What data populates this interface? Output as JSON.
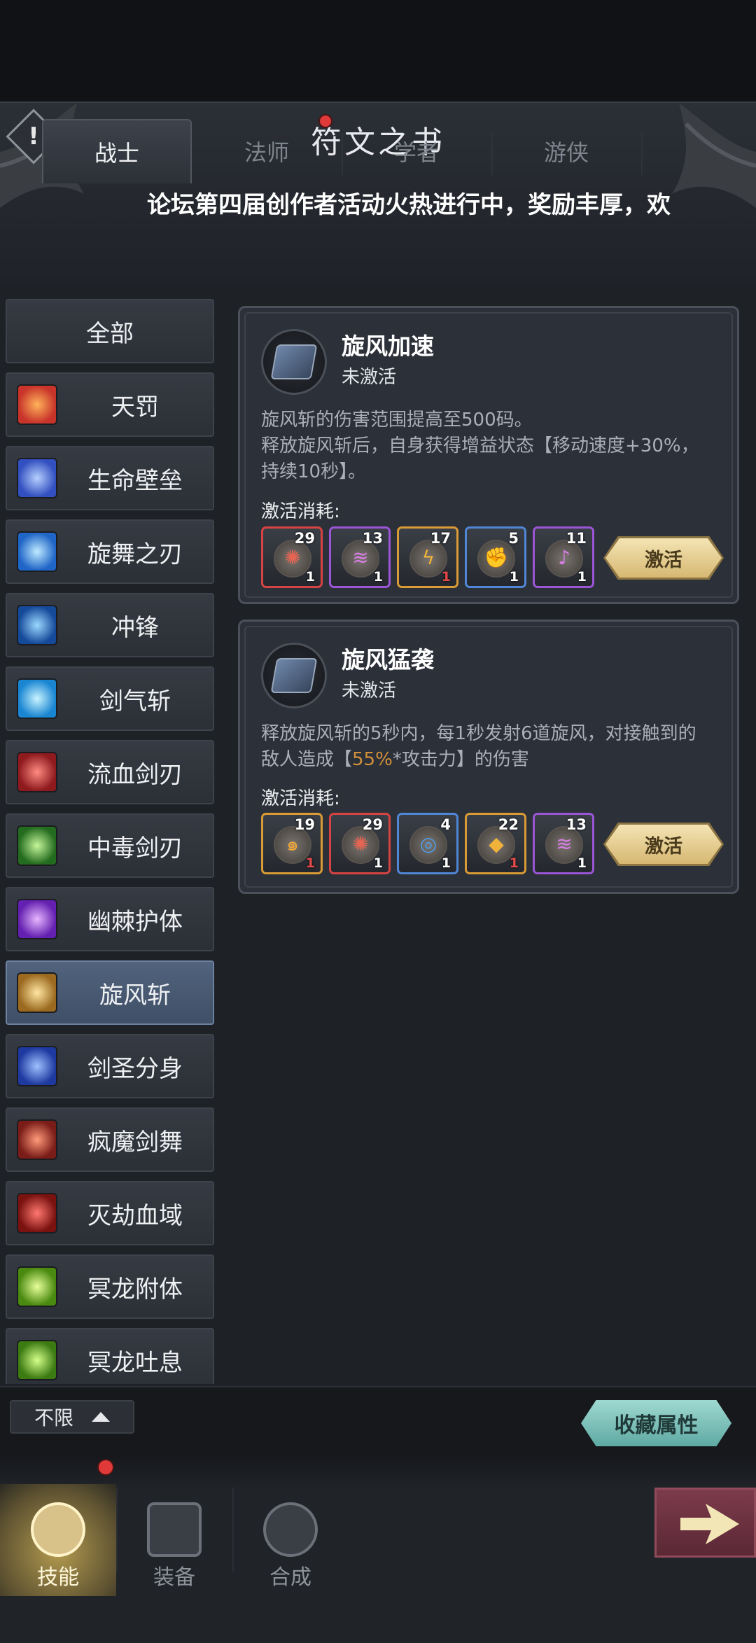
{
  "header": {
    "title": "符文之书",
    "alert_icon_glyph": "!",
    "announcement": "论坛第四届创作者活动火热进行中，奖励丰厚，欢"
  },
  "class_tabs": [
    {
      "label": "战士",
      "active": true
    },
    {
      "label": "法师",
      "active": false
    },
    {
      "label": "学者",
      "active": false
    },
    {
      "label": "游侠",
      "active": false
    }
  ],
  "sidebar": {
    "items": [
      {
        "label": "全部",
        "icon": "",
        "color": ""
      },
      {
        "label": "天罚",
        "icon": "fire-slash-icon",
        "color": "#e2562a"
      },
      {
        "label": "生命壁垒",
        "icon": "shield-icon",
        "color": "#3f6fd6"
      },
      {
        "label": "旋舞之刃",
        "icon": "spiral-blade-icon",
        "color": "#2f8fd8"
      },
      {
        "label": "冲锋",
        "icon": "charge-icon",
        "color": "#2a7fd0"
      },
      {
        "label": "剑气斩",
        "icon": "sword-wave-icon",
        "color": "#38a8e0"
      },
      {
        "label": "流血剑刃",
        "icon": "bleed-blade-icon",
        "color": "#c82f32"
      },
      {
        "label": "中毒剑刃",
        "icon": "poison-blade-icon",
        "color": "#4da23a"
      },
      {
        "label": "幽棘护体",
        "icon": "thorn-aura-icon",
        "color": "#8b43d0"
      },
      {
        "label": "旋风斩",
        "icon": "whirlwind-icon",
        "color": "#d0962f",
        "active": true
      },
      {
        "label": "剑圣分身",
        "icon": "clone-icon",
        "color": "#3a63d0"
      },
      {
        "label": "疯魔剑舞",
        "icon": "frenzy-icon",
        "color": "#c0392f"
      },
      {
        "label": "灭劫血域",
        "icon": "blood-domain-icon",
        "color": "#b52a2a"
      },
      {
        "label": "冥龙附体",
        "icon": "dragon-icon",
        "color": "#79b82a"
      },
      {
        "label": "冥龙吐息",
        "icon": "dragon-breath-icon",
        "color": "#6fae28"
      }
    ]
  },
  "runes": [
    {
      "name": "旋风加速",
      "status": "未激活",
      "icon": "whirlwind-rune-icon",
      "description_lines": [
        "旋风斩的伤害范围提高至500码。",
        "释放旋风斩后，自身获得增益状态【移动速度+30%，",
        "持续10秒】。"
      ],
      "cost_label": "激活消耗:",
      "costs": [
        {
          "need": "29",
          "have": "1",
          "color": "red",
          "icon": "red-whirl-gem-icon",
          "glyph": "✺",
          "glyph_color": "#e56452"
        },
        {
          "need": "13",
          "have": "1",
          "color": "purple",
          "icon": "purple-wind-gem-icon",
          "glyph": "≋",
          "glyph_color": "#d77ee6"
        },
        {
          "need": "17",
          "have": "1",
          "color": "orange",
          "icon": "orange-lightning-gem-icon",
          "glyph": "ϟ",
          "glyph_color": "#f1b23a",
          "insufficient": true
        },
        {
          "need": "5",
          "have": "1",
          "color": "blue",
          "icon": "blue-fist-gem-icon",
          "glyph": "✊",
          "glyph_color": "#4f9be8"
        },
        {
          "need": "11",
          "have": "1",
          "color": "purple",
          "icon": "purple-horn-gem-icon",
          "glyph": "♪",
          "glyph_color": "#d77ee6"
        }
      ],
      "activate_label": "激活"
    },
    {
      "name": "旋风猛袭",
      "status": "未激活",
      "icon": "whirlwind-rune-icon",
      "description_lines": [
        "释放旋风斩的5秒内，每1秒发射6道旋风，对接触到的"
      ],
      "description_line2_pre": "敌人造成【",
      "description_line2_hl": "55%",
      "description_line2_post": "*攻击力】的伤害",
      "cost_label": "激活消耗:",
      "costs": [
        {
          "need": "19",
          "have": "1",
          "color": "orange",
          "icon": "orange-swirl-gem-icon",
          "glyph": "๑",
          "glyph_color": "#f1a83a",
          "insufficient": true
        },
        {
          "need": "29",
          "have": "1",
          "color": "red",
          "icon": "red-whirl-gem-icon",
          "glyph": "✺",
          "glyph_color": "#e56452"
        },
        {
          "need": "4",
          "have": "1",
          "color": "blue",
          "icon": "blue-vortex-gem-icon",
          "glyph": "◎",
          "glyph_color": "#4f9be8"
        },
        {
          "need": "22",
          "have": "1",
          "color": "orange",
          "icon": "orange-shard-gem-icon",
          "glyph": "◆",
          "glyph_color": "#f1b23a",
          "insufficient": true
        },
        {
          "need": "13",
          "have": "1",
          "color": "purple",
          "icon": "purple-wind-gem-icon",
          "glyph": "≋",
          "glyph_color": "#d77ee6"
        }
      ],
      "activate_label": "激活"
    }
  ],
  "bottom": {
    "filter_label": "不限",
    "collect_label": "收藏属性"
  },
  "nav": [
    {
      "label": "技能",
      "icon": "sword-icon",
      "active": true
    },
    {
      "label": "装备",
      "icon": "card-icon",
      "active": false
    },
    {
      "label": "合成",
      "icon": "synthesis-icon",
      "active": false
    }
  ]
}
